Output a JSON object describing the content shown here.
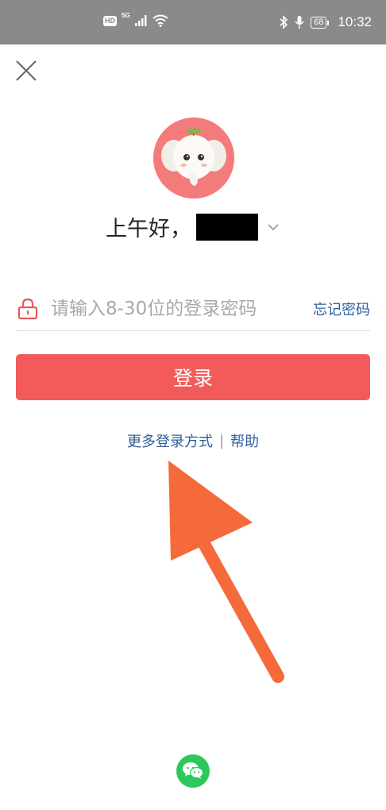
{
  "status_bar": {
    "network_badge": "HD",
    "network_type": "5G",
    "battery": "68",
    "time": "10:32",
    "icons": [
      "signal-icon",
      "wifi-icon",
      "bluetooth-icon",
      "mic-icon",
      "battery-icon"
    ]
  },
  "header": {
    "close_icon": "close-icon"
  },
  "greeting": {
    "text": "上午好，"
  },
  "password": {
    "placeholder": "请输入8-30位的登录密码",
    "forgot_label": "忘记密码",
    "icon": "lock-icon"
  },
  "login": {
    "button_label": "登录"
  },
  "links": {
    "more_login": "更多登录方式",
    "separator": "|",
    "help": "帮助"
  },
  "social": {
    "icon": "wechat-icon"
  },
  "colors": {
    "primary": "#f35b5b",
    "link": "#2d5f9a",
    "arrow": "#f56a3b",
    "wechat": "#2dc85d",
    "status_bar": "#8a8a8a"
  }
}
